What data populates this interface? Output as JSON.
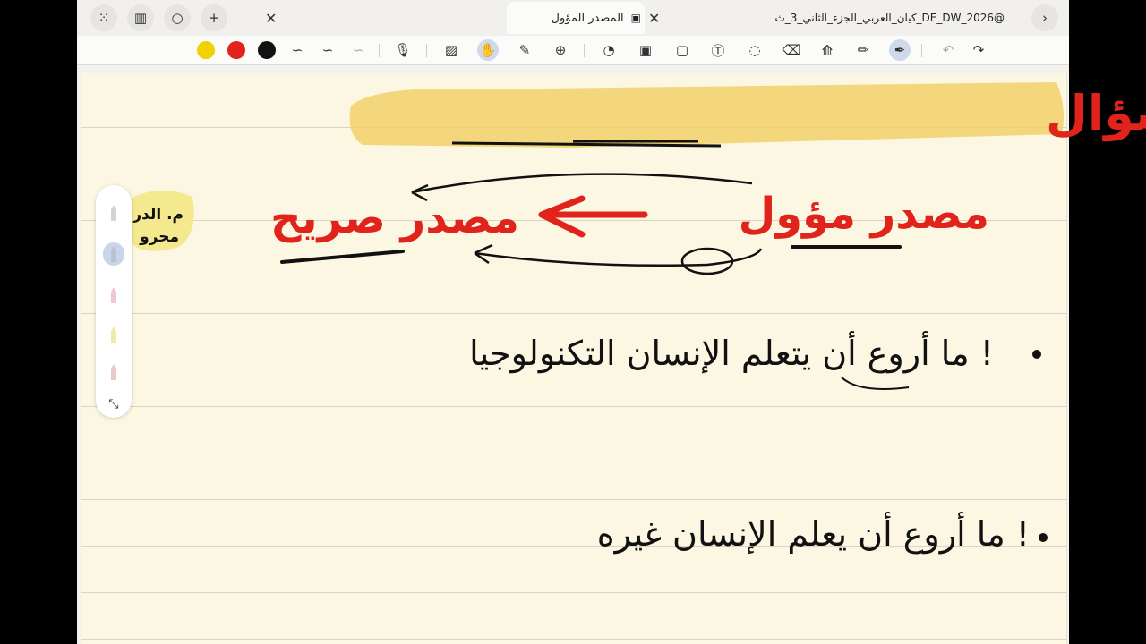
{
  "tabs": [
    {
      "label": "المصدر المؤول",
      "active": true
    },
    {
      "label": "كيان_العربي_الجزء_الثاني_3_ث_DE_DW_2026@",
      "active": false
    }
  ],
  "toolbar": {
    "colors": [
      "#f2d100",
      "#e0241b",
      "#111111"
    ],
    "selected_tools": [
      "pen-tool",
      "hand-touch-tool"
    ]
  },
  "note": {
    "heading": "ثالثاً: فكرة سؤال",
    "arrow_left": "مصدر مؤول",
    "arrow_right": "مصدر صريح",
    "side_note_line1": "م. الدر",
    "side_note_line2": "محرو",
    "line1": "ما أروع أن يتعلم الإنسان التكنولوجيا !",
    "line2": "ما أروع أن يعلم الإنسان غيره !"
  }
}
